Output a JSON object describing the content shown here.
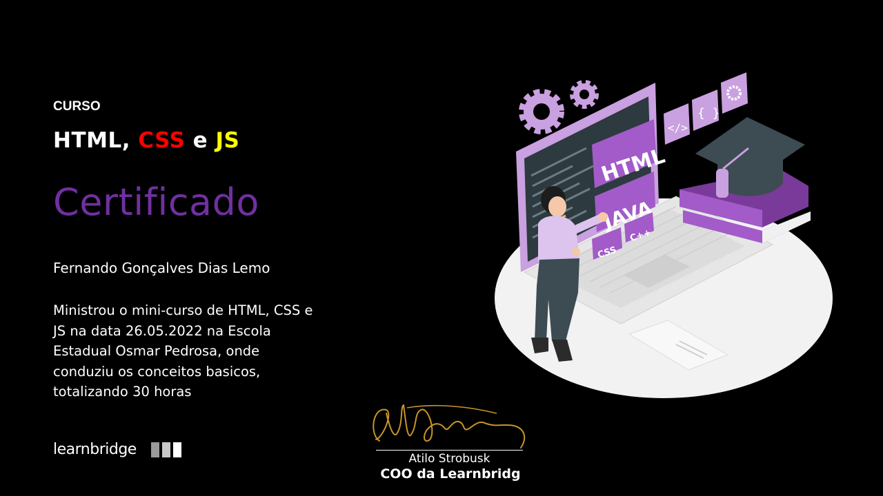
{
  "label": "CURSO",
  "course": {
    "part1": "HTML, ",
    "part2": "CSS",
    "part3": " e ",
    "part4": "JS"
  },
  "certificate_title": "Certificado",
  "recipient": "Fernando Gonçalves Dias Lemo",
  "description": "Ministrou o mini-curso de HTML, CSS e JS na data 26.05.2022  na Escola Estadual Osmar Pedrosa, onde conduziu os conceitos basicos, totalizando 30 horas",
  "brand": {
    "name": "learnbridge"
  },
  "signature": {
    "name": "Atilo Strobusk",
    "role": "COO da Learnbridg"
  },
  "illustration": {
    "labels": {
      "html": "HTML",
      "java": "JAVA",
      "css": "CSS",
      "cpp": "C++",
      "code": "</>",
      "braces": "{ }"
    },
    "icons": [
      "gear-icon",
      "code-icon",
      "braces-icon",
      "settings-icon",
      "graduation-cap-icon",
      "books-icon",
      "laptop-icon",
      "woman-teacher"
    ]
  },
  "colors": {
    "accent": "#7030a0",
    "css": "#ff0000",
    "js": "#ffff00",
    "purple": "#a25bc8",
    "light_purple": "#c9a0e0"
  }
}
